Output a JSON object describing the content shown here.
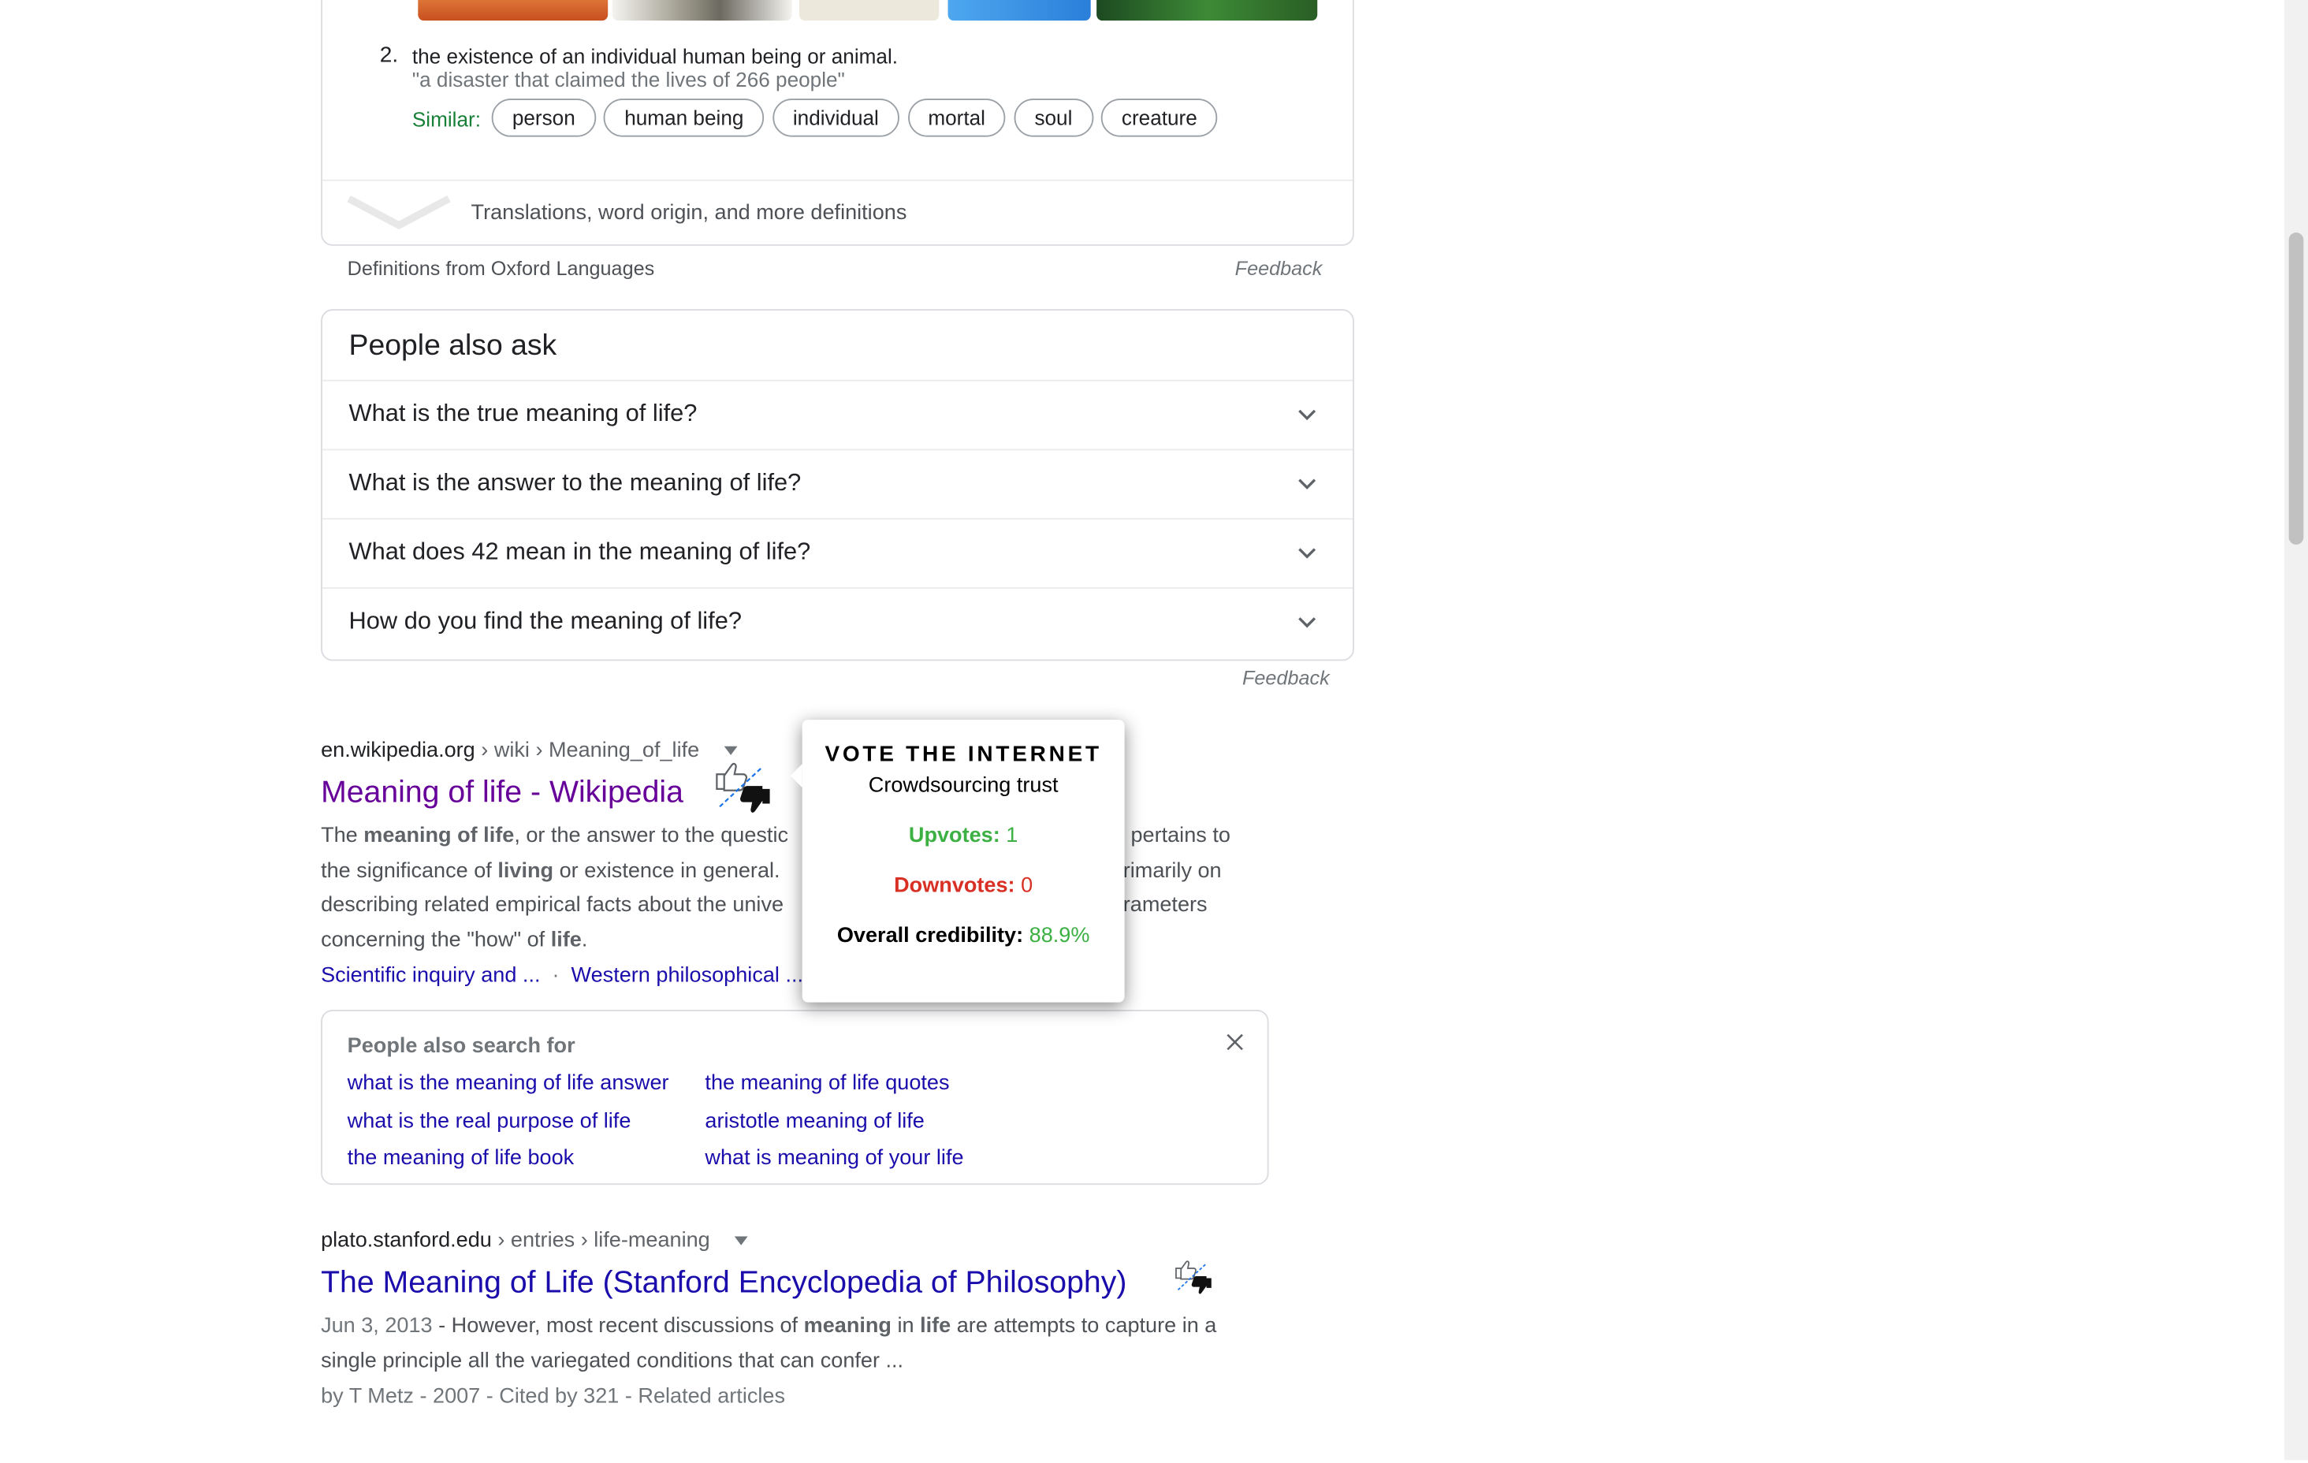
{
  "dictionary": {
    "thumb_colors": [
      "#d9652b",
      "#8d8a7d",
      "#e9e4d6",
      "#3b8fe0",
      "#2c6e2a"
    ],
    "sense_number": "2.",
    "definition": "the existence of an individual human being or animal.",
    "example": "\"a disaster that claimed the lives of 266 people\"",
    "similar_label": "Similar:",
    "similar_words": [
      "person",
      "human being",
      "individual",
      "mortal",
      "soul",
      "creature"
    ],
    "more_definitions": "Translations, word origin, and more definitions",
    "source": "Definitions from Oxford Languages",
    "feedback": "Feedback"
  },
  "people_also_ask": {
    "title": "People also ask",
    "questions": [
      "What is the true meaning of life?",
      "What is the answer to the meaning of life?",
      "What does 42 mean in the meaning of life?",
      "How do you find the meaning of life?"
    ],
    "feedback": "Feedback"
  },
  "results": [
    {
      "domain": "en.wikipedia.org",
      "path": " › wiki › Meaning_of_life",
      "title": "Meaning of life - Wikipedia",
      "snippet": {
        "t1": "The ",
        "b1": "meaning of life",
        "t2": ", or the answer to the questic",
        "t3": "\", pertains to",
        "t4": "the significance of ",
        "b2": "living",
        "t5": " or existence in general.",
        "t6": "rimarily on",
        "t7": "describing related empirical facts about the unive",
        "t8": "rameters",
        "t9": "concerning the \"how\" of ",
        "b3": "life",
        "t10": "."
      },
      "sitelinks": [
        "Scientific inquiry and ...",
        "Western philosophical ..."
      ],
      "sitelink_sep": "·"
    },
    {
      "domain": "plato.stanford.edu",
      "path": " › entries › life-meaning",
      "title": "The Meaning of Life (Stanford Encyclopedia of Philosophy)",
      "snippet": {
        "date": "Jun 3, 2013",
        "t1": " - However, most recent discussions of ",
        "b1": "meaning",
        "t2": " in ",
        "b2": "life",
        "t3": " are attempts to capture in a",
        "t4": "single principle all the variegated conditions that can confer ..."
      },
      "meta": "by T Metz - 2007 - Cited by 321 - Related articles"
    }
  ],
  "tooltip": {
    "title": "VOTE THE INTERNET",
    "subtitle": "Crowdsourcing trust",
    "upvotes_label": "Upvotes:",
    "upvotes_value": "1",
    "downvotes_label": "Downvotes:",
    "downvotes_value": "0",
    "credibility_label": "Overall credibility:",
    "credibility_value": "88.9%",
    "colors": {
      "up": "#3cb043",
      "down": "#d93025"
    }
  },
  "people_also_search": {
    "title": "People also search for",
    "links": [
      "what is the meaning of life answer",
      "the meaning of life quotes",
      "what is the real purpose of life",
      "aristotle meaning of life",
      "the meaning of life book",
      "what is meaning of your life"
    ]
  },
  "colors": {
    "link": "#1a0dab",
    "visited": "#660099",
    "similar_green": "#188038"
  }
}
